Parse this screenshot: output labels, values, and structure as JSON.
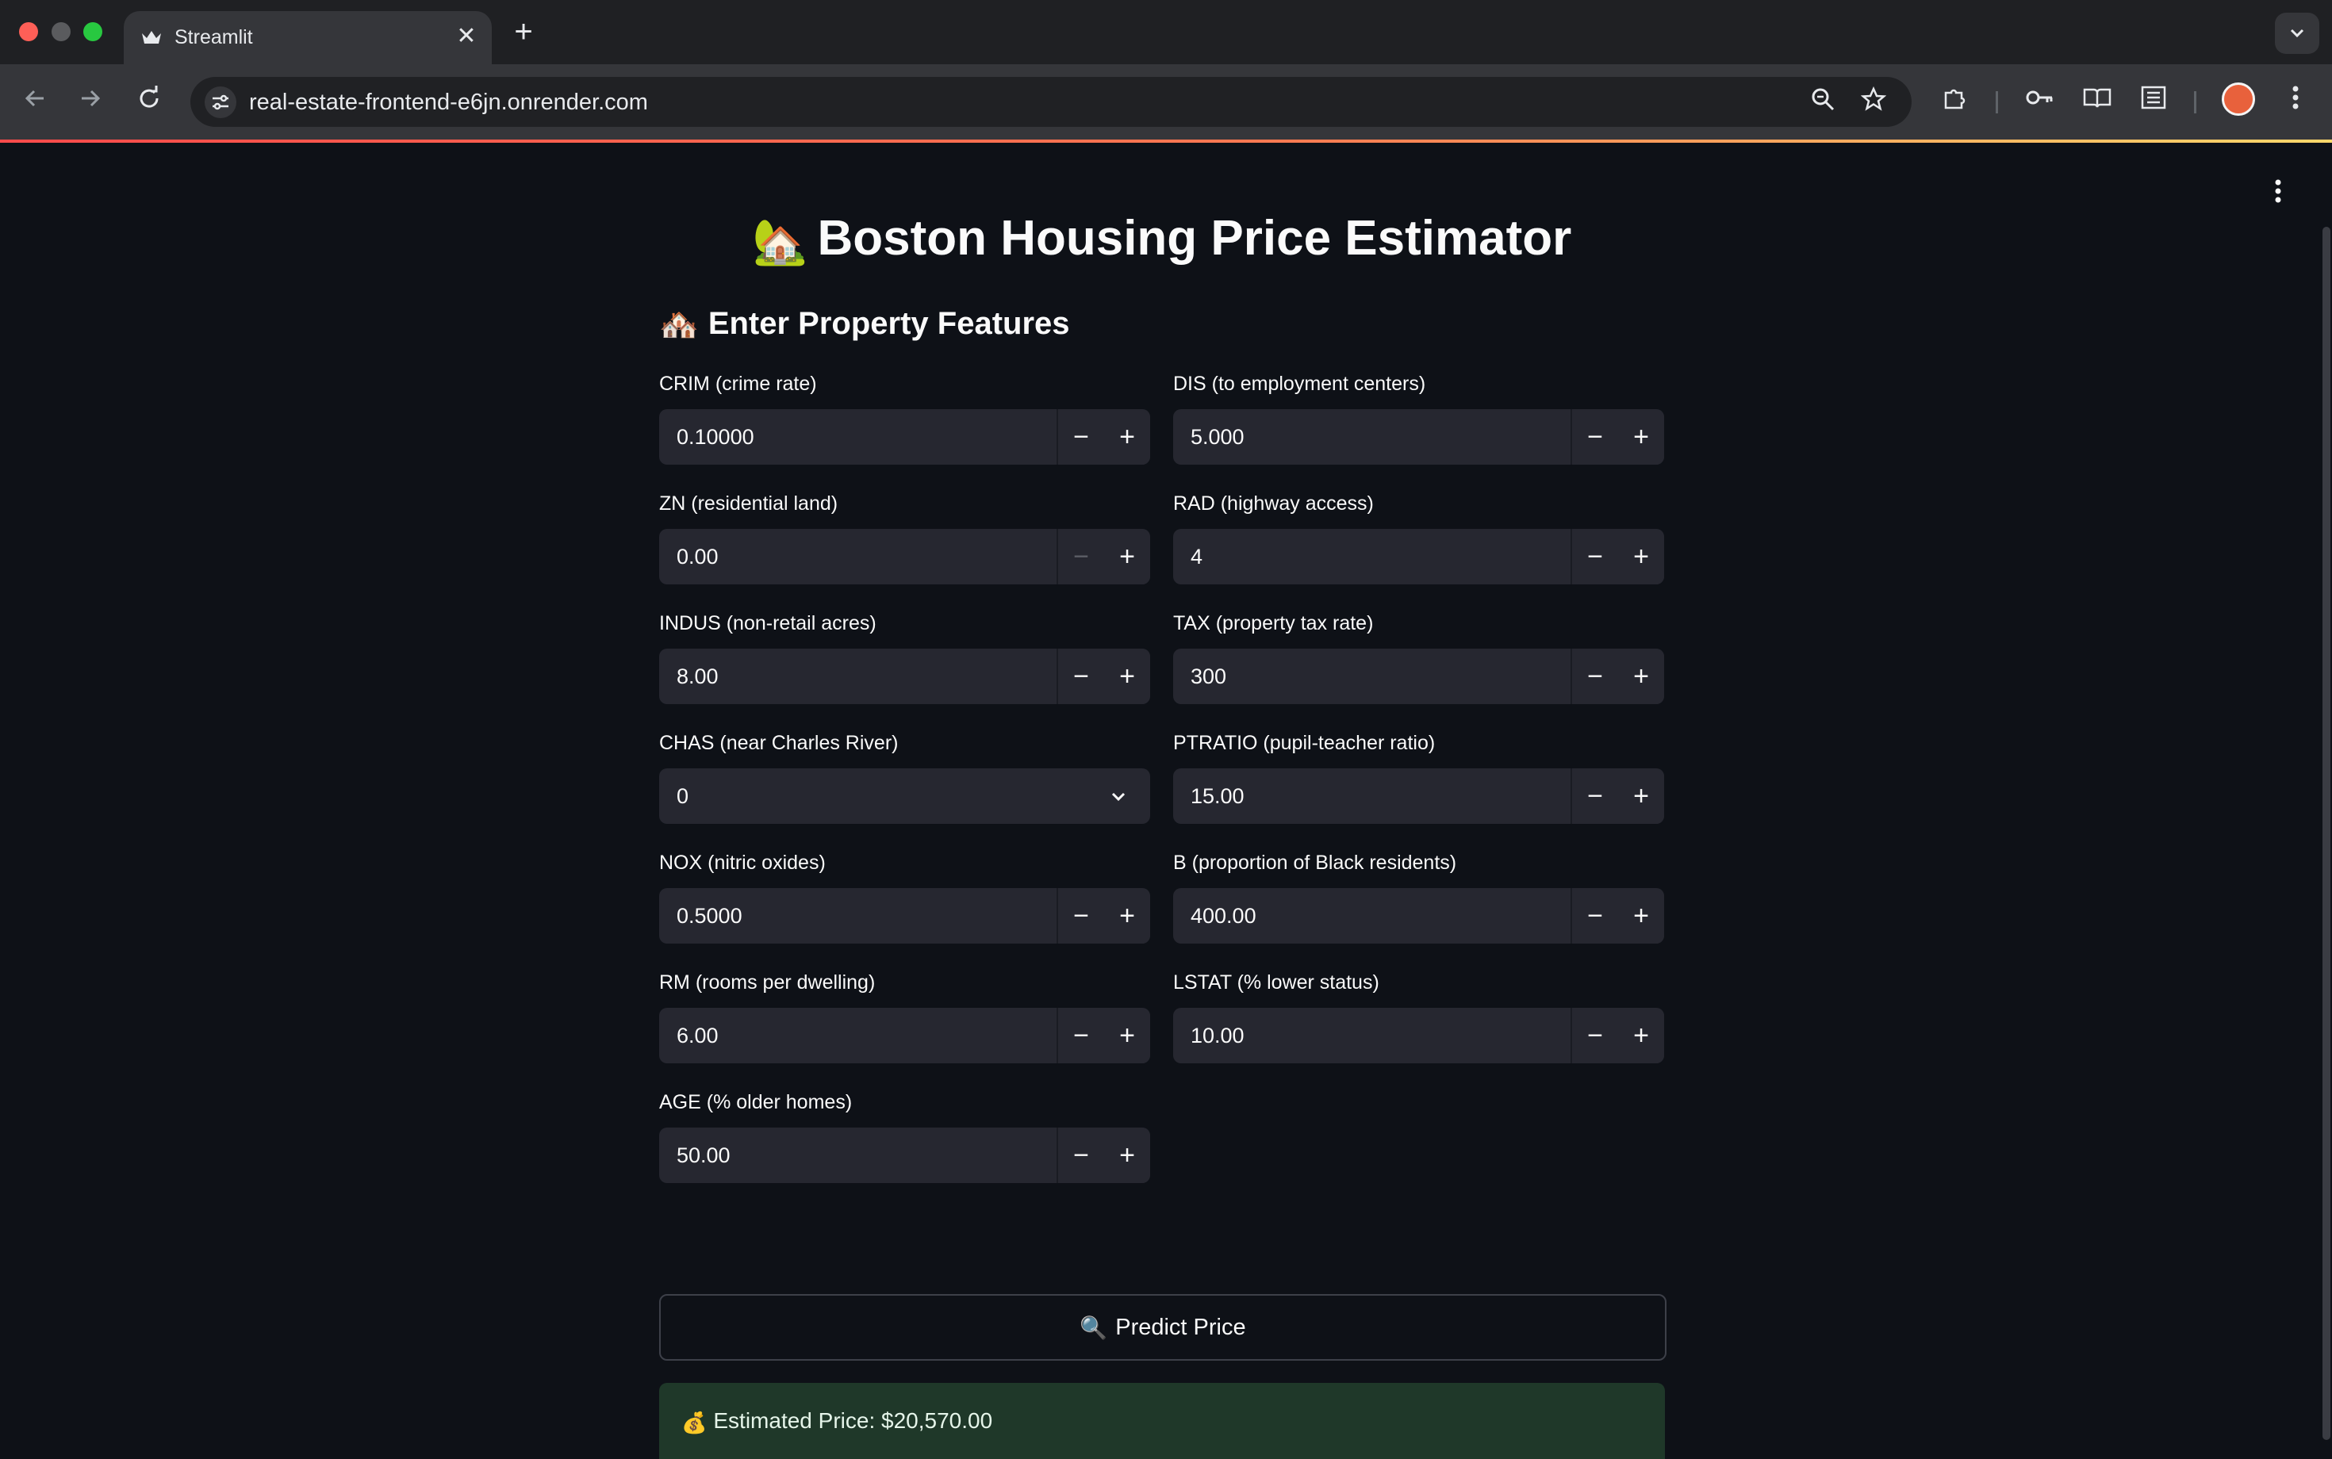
{
  "browser": {
    "tab_title": "Streamlit",
    "tab_favicon": "crown-icon",
    "close_glyph": "✕",
    "new_tab_glyph": "+",
    "url": "real-estate-frontend-e6jn.onrender.com",
    "colors": {
      "progress_start": "#ff4b4b",
      "progress_end": "#ffd86b"
    }
  },
  "app": {
    "title_emoji": "🏡",
    "title": "Boston Housing Price Estimator",
    "subheader_emoji": "🏘️",
    "subheader": "Enter Property Features",
    "left_fields": [
      {
        "label": "CRIM (crime rate)",
        "value": "0.10000",
        "type": "number"
      },
      {
        "label": "ZN (residential land)",
        "value": "0.00",
        "type": "number",
        "minus_disabled": true
      },
      {
        "label": "INDUS (non-retail acres)",
        "value": "8.00",
        "type": "number"
      },
      {
        "label": "CHAS (near Charles River)",
        "value": "0",
        "type": "select"
      },
      {
        "label": "NOX (nitric oxides)",
        "value": "0.5000",
        "type": "number"
      },
      {
        "label": "RM (rooms per dwelling)",
        "value": "6.00",
        "type": "number"
      },
      {
        "label": "AGE (% older homes)",
        "value": "50.00",
        "type": "number"
      }
    ],
    "right_fields": [
      {
        "label": "DIS (to employment centers)",
        "value": "5.000",
        "type": "number"
      },
      {
        "label": "RAD (highway access)",
        "value": "4",
        "type": "number"
      },
      {
        "label": "TAX (property tax rate)",
        "value": "300",
        "type": "number"
      },
      {
        "label": "PTRATIO (pupil-teacher ratio)",
        "value": "15.00",
        "type": "number"
      },
      {
        "label": "B (proportion of Black residents)",
        "value": "400.00",
        "type": "number"
      },
      {
        "label": "LSTAT (% lower status)",
        "value": "10.00",
        "type": "number"
      }
    ],
    "predict_emoji": "🔍",
    "predict_label": "Predict Price",
    "result_emoji": "💰",
    "result_text": "Estimated Price: $20,570.00",
    "colors": {
      "background": "#0e1117",
      "input_bg": "#262730",
      "success_bg": "#1f3829"
    }
  }
}
